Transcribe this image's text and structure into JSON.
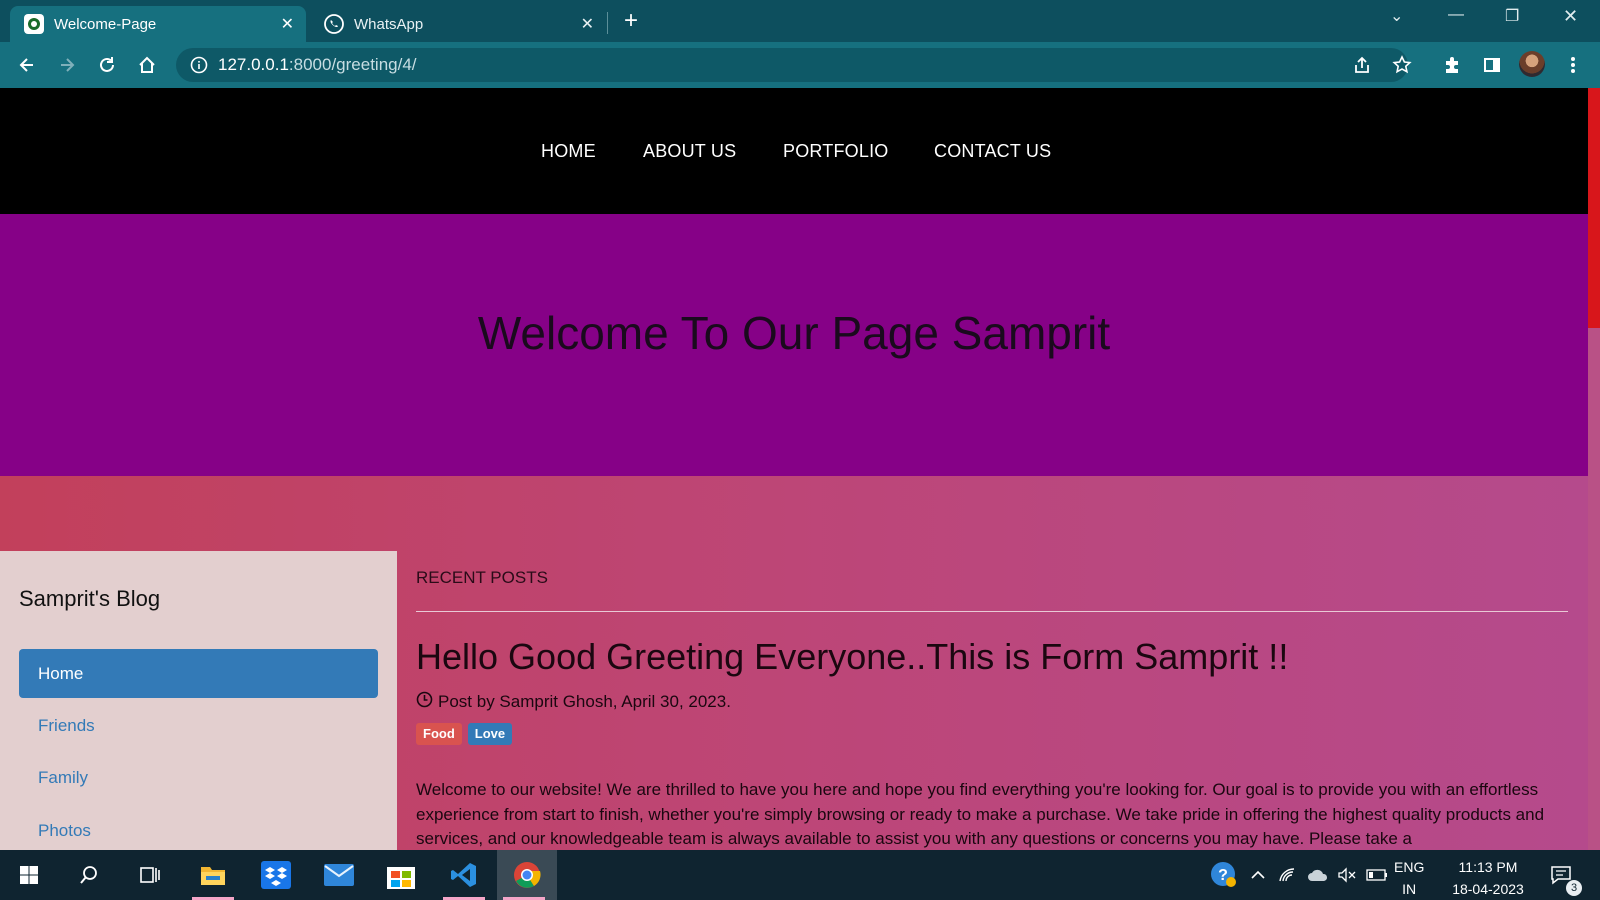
{
  "browser": {
    "tabs": [
      {
        "title": "Welcome-Page",
        "active": true
      },
      {
        "title": "WhatsApp",
        "active": false
      }
    ],
    "url_host": "127.0.0.1",
    "url_path": ":8000/greeting/4/"
  },
  "site": {
    "nav": [
      "HOME",
      "ABOUT US",
      "PORTFOLIO",
      "CONTACT US"
    ],
    "hero_title": "Welcome To Our Page Samprit",
    "sidebar": {
      "title": "Samprit's Blog",
      "items": [
        "Home",
        "Friends",
        "Family",
        "Photos"
      ],
      "active_index": 0
    },
    "main": {
      "section_label": "RECENT POSTS",
      "post_title": "Hello Good Greeting Everyone..This is Form Samprit !!",
      "meta": "Post by Samprit Ghosh, April 30, 2023.",
      "tags": [
        "Food",
        "Love"
      ],
      "body": "Welcome to our website! We are thrilled to have you here and hope you find everything you're looking for. Our goal is to provide you with an effortless experience from start to finish, whether you're simply browsing or ready to make a purchase. We take pride in offering the highest quality products and services, and our knowledgeable team is always available to assist you with any questions or concerns you may have. Please take a"
    }
  },
  "taskbar": {
    "lang_top": "ENG",
    "lang_bottom": "IN",
    "time": "11:13 PM",
    "date": "18-04-2023",
    "notification_count": "3"
  },
  "colors": {
    "tab_strip": "#0d4f5e",
    "toolbar": "#16707f",
    "hero": "#860187",
    "nav": "#000000",
    "link_blue": "#337ab7",
    "tag_food": "#d9534f",
    "tag_love": "#337ab7",
    "taskbar": "#0f2430"
  }
}
